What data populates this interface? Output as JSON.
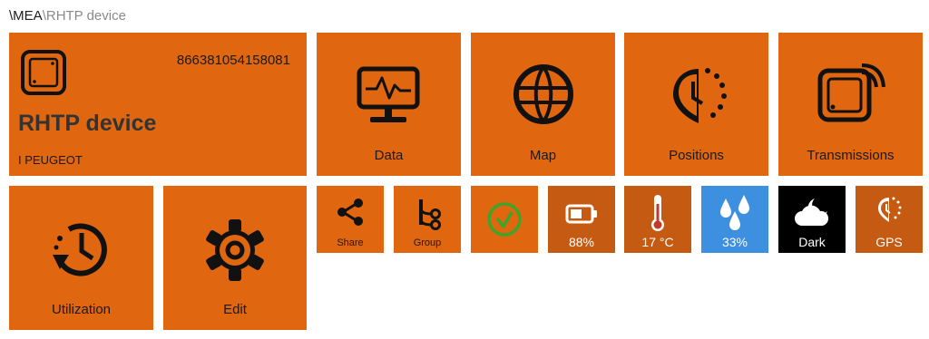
{
  "breadcrumb": {
    "root": "\\MEA",
    "separator": "\\",
    "current": "RHTP device"
  },
  "device": {
    "imei": "866381054158081",
    "name": "RHTP device",
    "owner": "I PEUGEOT"
  },
  "tiles": {
    "data": "Data",
    "map": "Map",
    "positions": "Positions",
    "transmissions": "Transmissions",
    "utilization": "Utilization",
    "edit": "Edit",
    "share": "Share",
    "group": "Group"
  },
  "status": {
    "battery": "88%",
    "temperature": "17 °C",
    "humidity": "33%",
    "light": "Dark",
    "gps": "GPS"
  },
  "colors": {
    "accent": "#e0670f",
    "status_dark_orange": "#c55a12",
    "humidity_blue": "#3d8fe0",
    "dark_tile": "#000000",
    "ok_green": "#3ea52a"
  },
  "icons": {
    "device": "device-icon",
    "data": "monitor-chart-icon",
    "map": "globe-icon",
    "positions": "location-clock-icon",
    "transmissions": "signal-device-icon",
    "utilization": "history-clock-icon",
    "edit": "gear-icon",
    "share": "share-icon",
    "group": "group-branch-icon",
    "ok": "checkmark-circle-icon",
    "battery": "battery-icon",
    "temperature": "thermometer-icon",
    "humidity": "droplets-icon",
    "light": "cloud-moon-icon",
    "gps": "gps-clock-icon"
  }
}
